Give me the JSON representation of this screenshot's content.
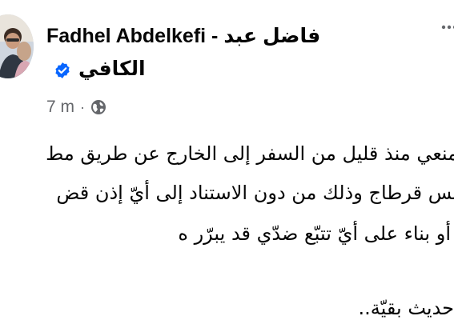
{
  "post": {
    "author": {
      "name_latin": "Fadhel Abdelkefi - فاضل عبد",
      "name_arabic": "الكافي",
      "verified": true,
      "avatar_icon": "profile-photo"
    },
    "timestamp": "7 m",
    "separator": "·",
    "audience_icon": "globe-icon",
    "menu_icon": "more-options-icon",
    "verified_color": "#0866ff",
    "text_lines": [
      "منعي منذ قليل من السفر إلى الخارج عن طريق مط",
      "نس قرطاج وذلك من دون الاستناد إلى أيّ إذن قض",
      "أو بناء على أيّ تتبّع ضدّي قد يبرّر ه",
      "حديث بقيّة.."
    ]
  }
}
